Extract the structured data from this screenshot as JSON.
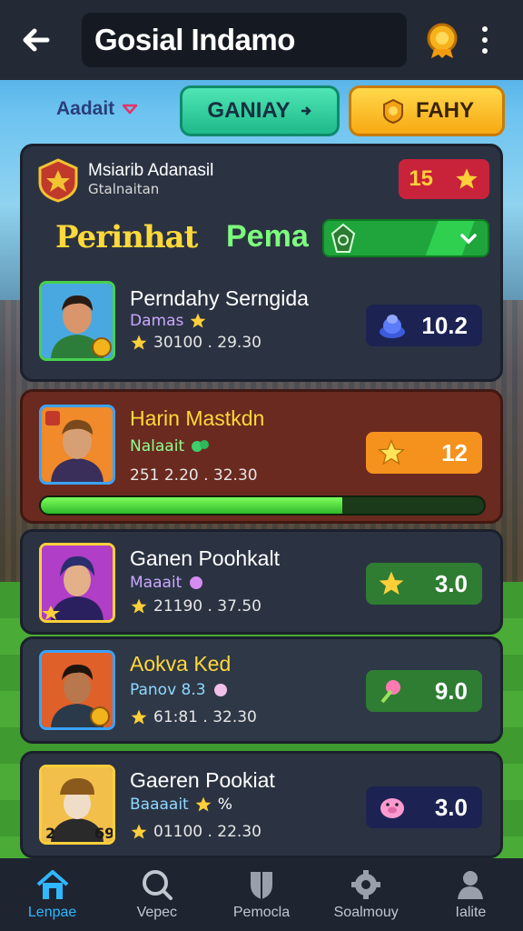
{
  "header": {
    "title": "Gosial Indamo"
  },
  "filters": {
    "dropdown_label": "Aadait",
    "tab_green": "GANIAY",
    "tab_yellow": "FAHY"
  },
  "club_card": {
    "name": "Msiarib Adanasil",
    "subtitle": "Gtalnaitan",
    "rank": "15",
    "headline_1": "Perinhat",
    "headline_2": "Pema",
    "player": {
      "name": "Perndahy Serngida",
      "tag": "Damas",
      "stats": "30100 . 29.30",
      "score": "10.2"
    }
  },
  "players": [
    {
      "name": "Harin Mastkdn",
      "tag": "Nalaait",
      "stats": "251 2.20 . 32.30",
      "score": "12",
      "progress": 0.68
    },
    {
      "name": "Ganen Poohkalt",
      "tag": "Maaait",
      "stats": "21190 . 37.50",
      "score": "3.0"
    },
    {
      "name": "Aokva Ked",
      "tag": "Panov 8.3",
      "stats": "61:81 . 32.30",
      "score": "9.0"
    },
    {
      "name": "Gaeren Pookiat",
      "tag": "Baaaait",
      "tag_extra": "%",
      "stats": "01100 . 22.30",
      "score": "3.0"
    }
  ],
  "nav": [
    {
      "label": "Lenpae",
      "icon": "home-icon"
    },
    {
      "label": "Vepec",
      "icon": "search-icon"
    },
    {
      "label": "Pemocla",
      "icon": "shield-icon"
    },
    {
      "label": "Soalmouy",
      "icon": "gear-icon"
    },
    {
      "label": "Ialite",
      "icon": "person-icon"
    }
  ],
  "colors": {
    "accent_blue": "#2fb7ff",
    "gold": "#ffd93a",
    "green": "#47d14f",
    "card_red": "#6b2a1f"
  }
}
